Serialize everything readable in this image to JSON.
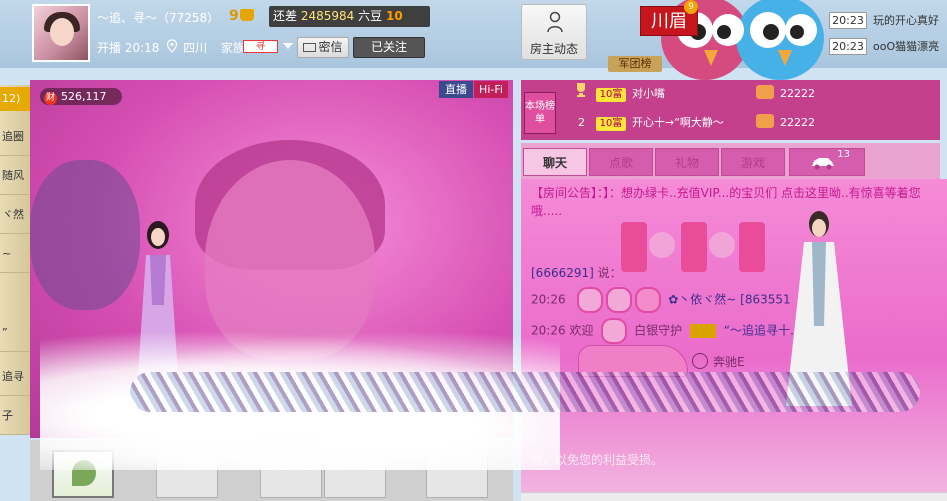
{
  "header": {
    "nickname": "～追、寻～（77258）",
    "level": "9",
    "beans_text": "还差",
    "beans_value": "2485984",
    "beans_unit": "六豆",
    "next_level": "10",
    "line2_start": "开播 20:18",
    "location": "四川",
    "family_label": "家族",
    "family_badge": "寻",
    "msg_button": "密信",
    "follow_button": "已关注",
    "host_button": "房主动态"
  },
  "banner": {
    "chuanmei": "川眉",
    "chuanmei_badge": "9",
    "army_button": "军团榜"
  },
  "news": [
    {
      "time": "20:23",
      "text": "玩的开心真好"
    },
    {
      "time": "20:23",
      "text": "ooO猫猫漂亮"
    }
  ],
  "sidebar": {
    "count": "12)",
    "items": [
      "追圈",
      "随风",
      "ヾ然",
      "~",
      "”",
      "追寻",
      "子"
    ]
  },
  "video": {
    "wealth_icon": "财",
    "wealth_value": "526,117",
    "live_tag": "直播",
    "hifi_tag": "Hi-Fi"
  },
  "rank": {
    "label": "本场榜单",
    "rows": [
      {
        "n": "1",
        "level": "10富",
        "name": "对小嘴",
        "value": "22222"
      },
      {
        "n": "2",
        "level": "10富",
        "name": "开心十→“啊大静～",
        "value": "22222"
      }
    ]
  },
  "tabs": [
    {
      "label": "聊天",
      "badge": ""
    },
    {
      "label": "点歌",
      "badge": ""
    },
    {
      "label": "礼物",
      "badge": ""
    },
    {
      "label": "游戏",
      "badge": ""
    },
    {
      "label": "",
      "badge": "13"
    }
  ],
  "chat": {
    "announcement": "【房间公告】：】：想办绿卡..充值VIP...的宝贝们 点击这里呦..有惊喜等着您哦.....",
    "line1_user": "[6666291]",
    "line1_suffix": "说：",
    "line2_time": "20:26",
    "line2_user": "✿丶依ヾ然~ [863551",
    "line3_time": "20:26",
    "line3_welcome": "欢迎",
    "line3_rank": "白银守护",
    "line3_name": "“～追追寻十…”光临",
    "car_label": "奔驰E",
    "bottom_note": "号，以免您的利益受损。"
  }
}
